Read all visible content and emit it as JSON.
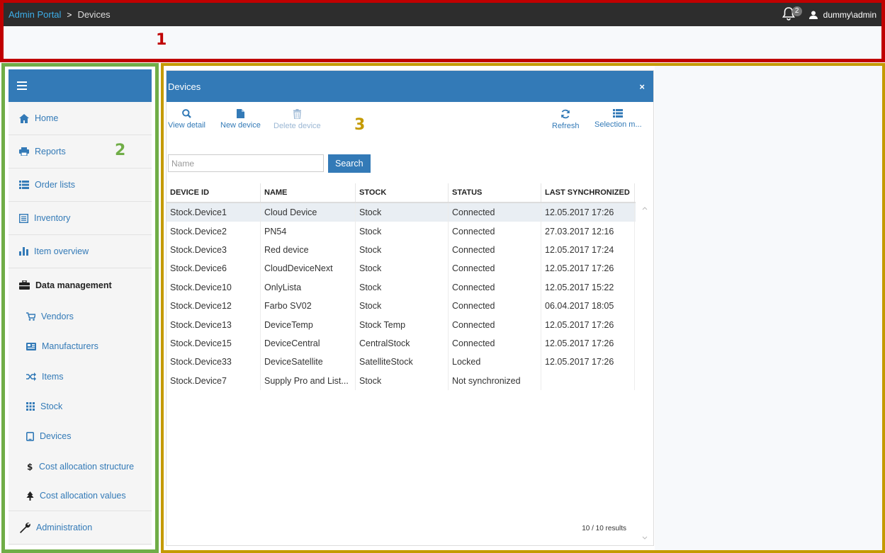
{
  "header": {
    "brand": "Admin Portal",
    "separator": ">",
    "breadcrumb": "Devices",
    "notification_count": "2",
    "user": "dummy\\admin"
  },
  "annotations": [
    "1",
    "2",
    "3"
  ],
  "sidebar": {
    "items": [
      {
        "label": "Home",
        "icon": "home-icon"
      },
      {
        "label": "Reports",
        "icon": "print-icon"
      },
      {
        "label": "Order lists",
        "icon": "list-icon"
      },
      {
        "label": "Inventory",
        "icon": "inventory-icon"
      },
      {
        "label": "Item overview",
        "icon": "bar-chart-icon"
      },
      {
        "label": "Data management",
        "icon": "briefcase-icon"
      }
    ],
    "sub_items": [
      {
        "label": "Vendors",
        "icon": "cart-icon"
      },
      {
        "label": "Manufacturers",
        "icon": "factory-icon"
      },
      {
        "label": "Items",
        "icon": "shuffle-icon"
      },
      {
        "label": "Stock",
        "icon": "grid-icon"
      },
      {
        "label": "Devices",
        "icon": "tablet-icon"
      },
      {
        "label": "Cost allocation structure",
        "icon": "dollar-icon"
      },
      {
        "label": "Cost allocation values",
        "icon": "tree-icon"
      }
    ],
    "footer_item": {
      "label": "Administration",
      "icon": "wrench-icon"
    }
  },
  "panel": {
    "title": "Devices",
    "close": "×",
    "toolbar": {
      "view_detail": "View detail",
      "new_device": "New device",
      "delete_device": "Delete device",
      "refresh": "Refresh",
      "selection_mode": "Selection m..."
    },
    "search": {
      "placeholder": "Name",
      "value": "",
      "button": "Search"
    },
    "columns": [
      "DEVICE ID",
      "NAME",
      "STOCK",
      "STATUS",
      "LAST SYNCHRONIZED"
    ],
    "rows": [
      [
        "Stock.Device1",
        "Cloud Device",
        "Stock",
        "Connected",
        "12.05.2017 17:26"
      ],
      [
        "Stock.Device2",
        "PN54",
        "Stock",
        "Connected",
        "27.03.2017 12:16"
      ],
      [
        "Stock.Device3",
        "Red device",
        "Stock",
        "Connected",
        "12.05.2017 17:24"
      ],
      [
        "Stock.Device6",
        "CloudDeviceNext",
        "Stock",
        "Connected",
        "12.05.2017 17:26"
      ],
      [
        "Stock.Device10",
        "OnlyLista",
        "Stock",
        "Connected",
        "12.05.2017 15:22"
      ],
      [
        "Stock.Device12",
        "Farbo SV02",
        "Stock",
        "Connected",
        "06.04.2017 18:05"
      ],
      [
        "Stock.Device13",
        "DeviceTemp",
        "Stock Temp",
        "Connected",
        "12.05.2017 17:26"
      ],
      [
        "Stock.Device15",
        "DeviceCentral",
        "CentralStock",
        "Connected",
        "12.05.2017 17:26"
      ],
      [
        "Stock.Device33",
        "DeviceSatellite",
        "SatelliteStock",
        "Locked",
        "12.05.2017 17:26"
      ],
      [
        "Stock.Device7",
        "Supply Pro and List...",
        "Stock",
        "Not synchronized",
        ""
      ]
    ],
    "results": "10 / 10 results"
  },
  "colors": {
    "accent": "#337ab7",
    "topbar": "#2d2d2d",
    "annot_red": "#c00000",
    "annot_green": "#70ad47",
    "annot_gold": "#c49a00"
  }
}
